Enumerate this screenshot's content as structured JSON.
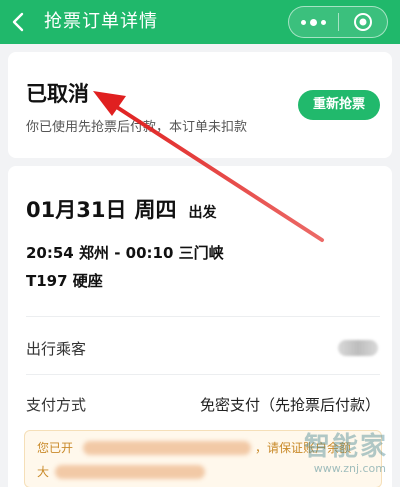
{
  "header": {
    "back_icon": "chevron-left-icon",
    "title": "抢票订单详情",
    "more_icon": "more-dots-icon",
    "target_icon": "target-circle-icon",
    "color": "#20b86b"
  },
  "status": {
    "title": "已取消",
    "subtitle": "你已使用先抢票后付款，本订单未扣款",
    "regrab_label": "重新抢票",
    "button_color": "#21b96c"
  },
  "trip": {
    "date": "01月31日",
    "weekday": "周四",
    "depart_label": "出发",
    "route": "20:54 郑州 - 00:10 三门峡",
    "train": "T197 硬座"
  },
  "details": [
    {
      "label": "出行乘客",
      "value": ""
    },
    {
      "label": "支付方式",
      "value": "免密支付（先抢票后付款）"
    }
  ],
  "notice": {
    "line1_start": "您已开",
    "line1_end": "，请保证账户余额",
    "line2_start": "大",
    "color": "#c98a2a"
  },
  "annotation": {
    "arrow_color": "#e53935"
  },
  "watermark": {
    "text": "智能家",
    "url": "www.znj.com"
  }
}
